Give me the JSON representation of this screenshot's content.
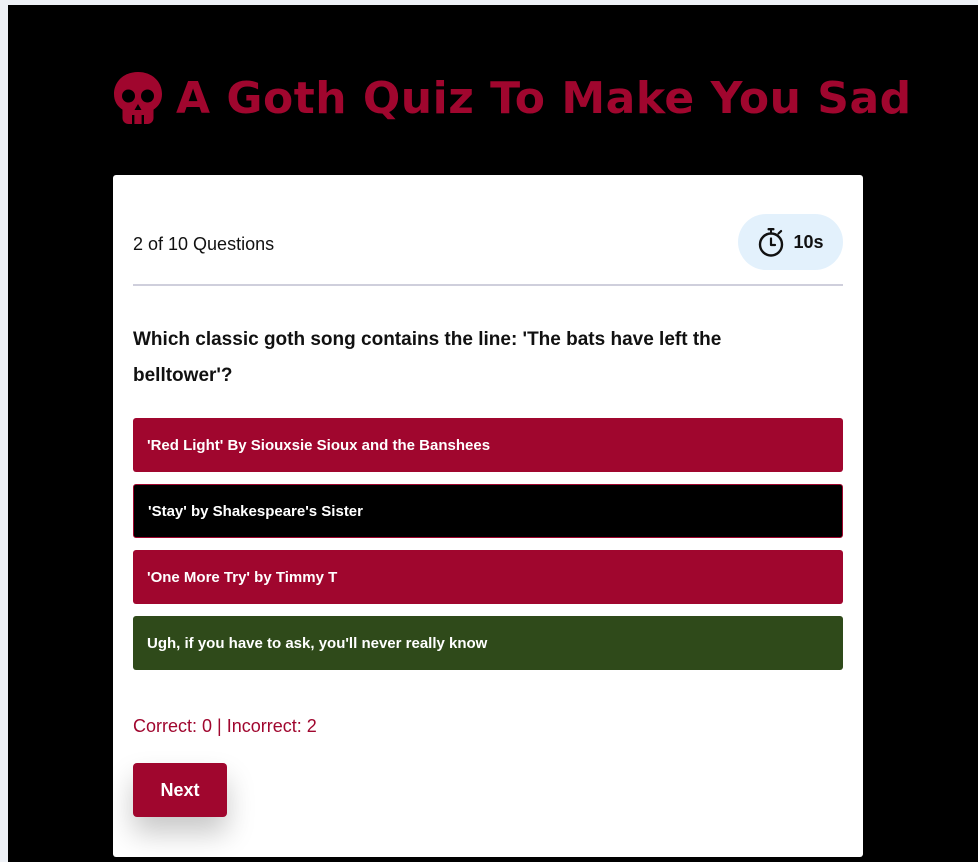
{
  "header": {
    "title": "A Goth Quiz To Make You Sad",
    "icon": "skull-icon"
  },
  "quiz": {
    "progress_text": "2 of 10 Questions",
    "timer": {
      "icon": "stopwatch-icon",
      "value": "10s"
    },
    "question": "Which classic goth song contains the line: 'The bats have left the belltower'?",
    "answers": [
      {
        "label": "'Red Light' By Siouxsie Sioux and the Banshees",
        "state": "incorrect"
      },
      {
        "label": "'Stay' by Shakespeare's Sister",
        "state": "selected"
      },
      {
        "label": "'One More Try' by Timmy T",
        "state": "incorrect"
      },
      {
        "label": "Ugh, if you have to ask, you'll never really know",
        "state": "correct"
      }
    ],
    "score_text": "Correct: 0 | Incorrect: 2",
    "next_label": "Next"
  },
  "colors": {
    "brand": "#a0062e",
    "background": "#000000",
    "correct": "#2f4a1a",
    "timer_bg": "#e3f1fc"
  }
}
